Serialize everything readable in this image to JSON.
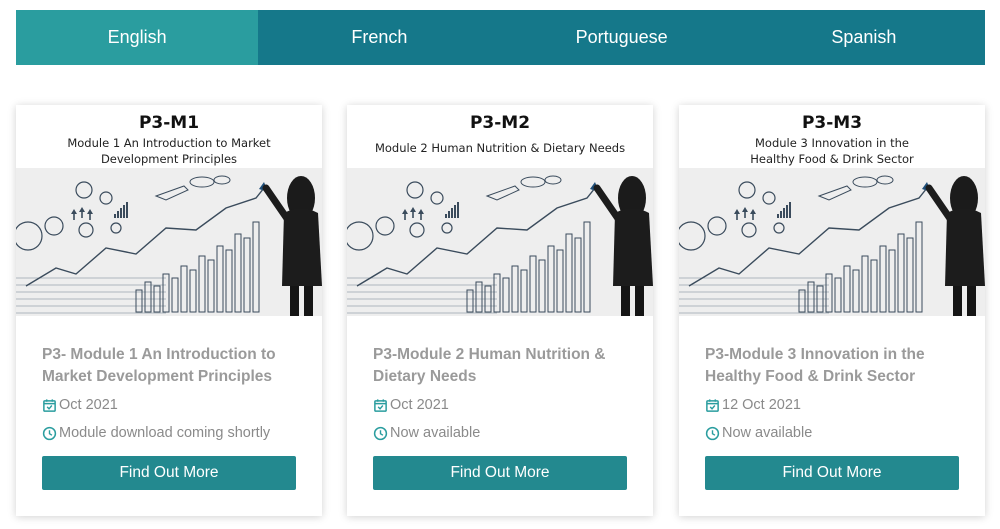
{
  "tabs": [
    {
      "label": "English",
      "active": true
    },
    {
      "label": "French",
      "active": false
    },
    {
      "label": "Portuguese",
      "active": false
    },
    {
      "label": "Spanish",
      "active": false
    }
  ],
  "colors": {
    "tab_bar": "#15788a",
    "tab_active": "#2a9d9f",
    "button": "#23898f",
    "icon": "#2a9d9f"
  },
  "cards": [
    {
      "code": "P3-M1",
      "subtitle": "Module 1 An Introduction to Market Development Principles",
      "title": "P3- Module 1 An Introduction to Market Development Principles",
      "date": "Oct 2021",
      "status": "Module download coming shortly",
      "button_label": "Find Out More",
      "image_icon": "businesswoman-chart-sketch-image"
    },
    {
      "code": "P3-M2",
      "subtitle": "Module 2 Human Nutrition & Dietary Needs",
      "title": "P3-Module 2 Human Nutrition & Dietary Needs",
      "date": "Oct 2021",
      "status": "Now available",
      "button_label": "Find Out More",
      "image_icon": "businesswoman-chart-sketch-image"
    },
    {
      "code": "P3-M3",
      "subtitle": "Module 3 Innovation in the Healthy Food & Drink Sector",
      "title": "P3-Module 3 Innovation in the Healthy Food & Drink Sector",
      "date": "12 Oct 2021",
      "status": "Now available",
      "button_label": "Find Out More",
      "image_icon": "businesswoman-chart-sketch-image"
    }
  ]
}
